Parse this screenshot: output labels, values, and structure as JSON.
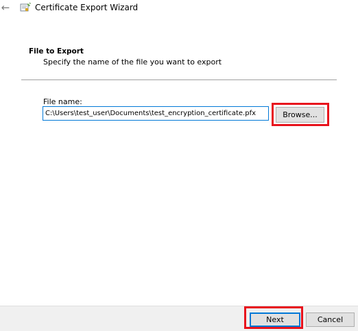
{
  "window": {
    "title": "Certificate Export Wizard",
    "back_icon": "back-arrow-icon",
    "app_icon": "certificate-wizard-icon"
  },
  "header": {
    "title": "File to Export",
    "subtitle": "Specify the name of the file you want to export"
  },
  "form": {
    "file_name_label": "File name:",
    "file_name_value": "C:\\Users\\test_user\\Documents\\test_encryption_certificate.pfx",
    "browse_label": "Browse..."
  },
  "footer": {
    "next_label": "Next",
    "cancel_label": "Cancel"
  },
  "colors": {
    "highlight": "#e8121c",
    "focus_accent": "#0078d7",
    "button_face": "#e1e1e1",
    "footer_background": "#f0f0f0"
  }
}
